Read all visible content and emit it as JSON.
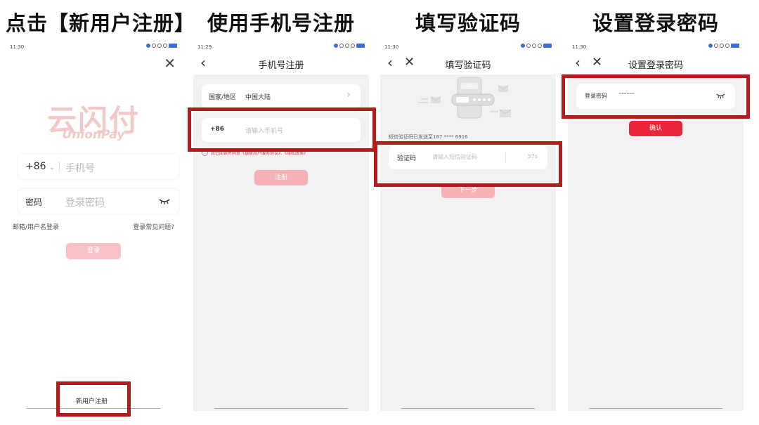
{
  "steps": [
    {
      "title": "点击【新用户注册】"
    },
    {
      "title": "使用手机号注册"
    },
    {
      "title": "填写验证码"
    },
    {
      "title": "设置登录密码"
    }
  ],
  "screen1": {
    "time": "11:30",
    "logo_cn": "云闪付",
    "logo_en": "UnionPay",
    "country_code": "+86",
    "phone_placeholder": "手机号",
    "password_label": "密码",
    "password_placeholder": "登录密码",
    "email_login": "邮箱/用户名登录",
    "login_help": "登录常见问题?",
    "login_button": "登录",
    "register_link": "新用户注册"
  },
  "screen2": {
    "time": "11:29",
    "nav_title": "手机号注册",
    "region_label": "国家/地区",
    "region_value": "中国大陆",
    "country_code": "+86",
    "phone_placeholder": "请输入手机号",
    "agreement": "我已阅读并同意《银联用户服务协议》、《隐私政策》",
    "register_button": "注册"
  },
  "screen3": {
    "time": "11:30",
    "nav_title": "填写验证码",
    "sent_notice": "短信验证码已发送至187 **** 6916",
    "code_label": "验证码",
    "code_placeholder": "请输入短信验证码",
    "countdown": "57s",
    "next_button": "下一步"
  },
  "screen4": {
    "time": "11:30",
    "nav_title": "设置登录密码",
    "password_label": "登录密码",
    "password_value": "············",
    "confirm_button": "确认"
  },
  "colors": {
    "accent_red": "#e8253a",
    "disabled_red": "#f6b3b7",
    "callout_red": "#b31c1c",
    "logo_pink": "#f3c9c8"
  }
}
